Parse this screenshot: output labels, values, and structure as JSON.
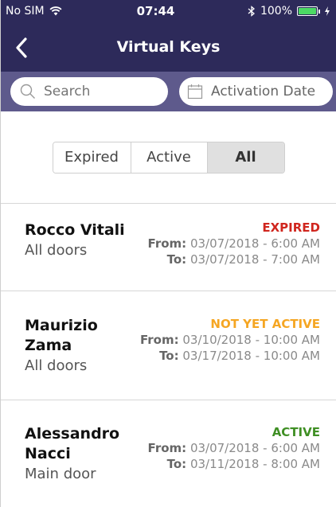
{
  "status_bar": {
    "carrier": "No SIM",
    "time": "07:44",
    "battery": "100%",
    "battery_level": 1.0
  },
  "header": {
    "title": "Virtual Keys",
    "back_icon": "chevron-left-icon"
  },
  "search": {
    "placeholder": "Search",
    "value": "",
    "date_label": "Activation Date"
  },
  "filters": {
    "options": [
      "Expired",
      "Active",
      "All"
    ],
    "selected": "All"
  },
  "keys": [
    {
      "name_lines": [
        "Rocco Vitali"
      ],
      "doors": "All doors",
      "status": "EXPIRED",
      "status_color": "#d0261e",
      "from_label": "From:",
      "from": "03/07/2018 - 6:00 AM",
      "to_label": "To:",
      "to": "03/07/2018 - 7:00 AM"
    },
    {
      "name_lines": [
        "Maurizio",
        "Zama"
      ],
      "doors": "All doors",
      "status": "NOT YET ACTIVE",
      "status_color": "#f5a623",
      "from_label": "From:",
      "from": "03/10/2018 - 10:00 AM",
      "to_label": "To:",
      "to": "03/17/2018 - 10:00 AM"
    },
    {
      "name_lines": [
        "Alessandro",
        "Nacci"
      ],
      "doors": "Main door",
      "status": "ACTIVE",
      "status_color": "#3f8f24",
      "from_label": "From:",
      "from": "03/07/2018 - 6:00 AM",
      "to_label": "To:",
      "to": "03/11/2018 - 8:00 AM"
    }
  ],
  "colors": {
    "header_bg": "#2d2a5a",
    "search_row_bg": "#5e5a8c",
    "segment_selected_bg": "#e0e0e0"
  }
}
